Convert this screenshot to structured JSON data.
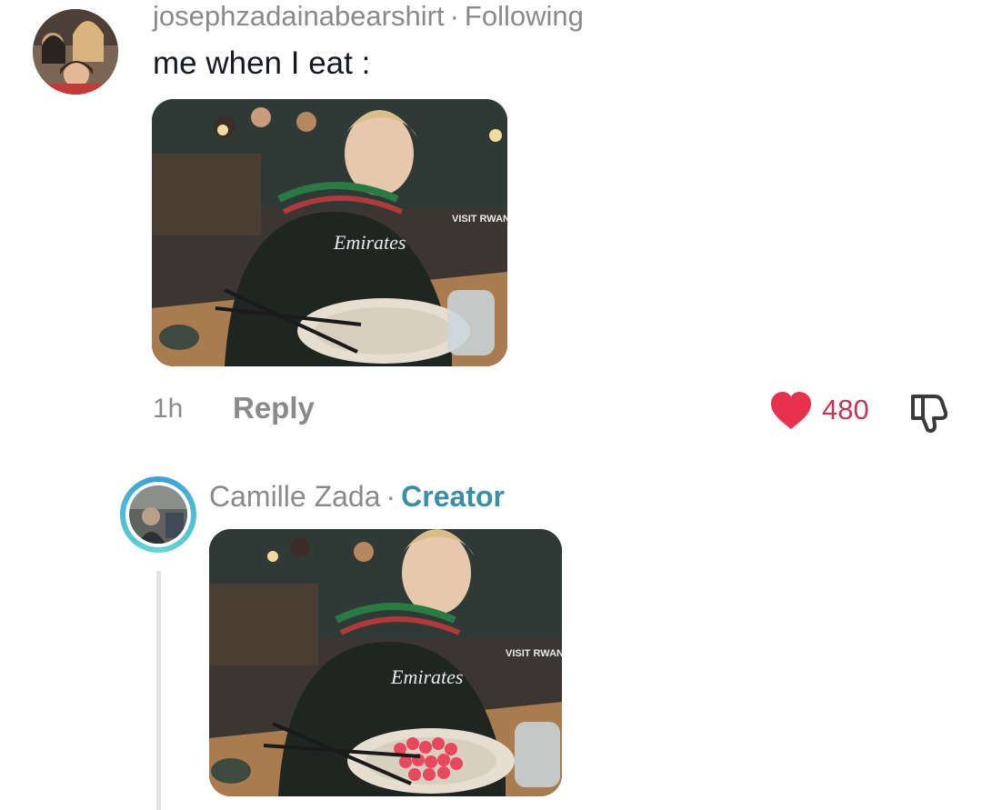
{
  "comment": {
    "username": "josephzadainabearshirt",
    "separator": "·",
    "follow_status": "Following",
    "text": "me when I eat :",
    "time": "1h",
    "reply_label": "Reply",
    "like_count": "480",
    "jersey_sponsor": "Emirates",
    "jersey_sleeve": "VISIT RWANDA"
  },
  "reply_comment": {
    "username": "Camille Zada",
    "separator": "·",
    "badge": "Creator"
  },
  "colors": {
    "heart": "#e8314f",
    "creator": "#3a8fa3",
    "muted": "#8a8a8a"
  },
  "icons": {
    "like": "heart-icon",
    "dislike": "thumbs-down-icon"
  }
}
